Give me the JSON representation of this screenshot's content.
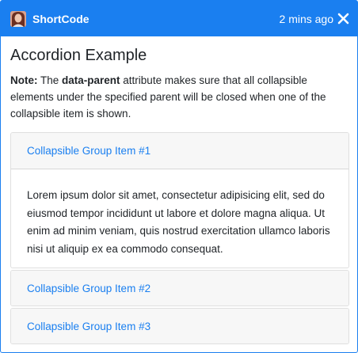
{
  "titlebar": {
    "app_name": "ShortCode",
    "time": "2 mins ago",
    "close_icon": "close-icon"
  },
  "main": {
    "heading": "Accordion Example",
    "note": {
      "label": "Note:",
      "text_1": " The ",
      "highlight": "data-parent",
      "text_2": " attribute makes sure that all collapsible elements under the specified parent will be closed when one of the collapsible item is shown."
    }
  },
  "accordion": {
    "items": [
      {
        "title": "Collapsible Group Item #1",
        "expanded": true,
        "body": "Lorem ipsum dolor sit amet, consectetur adipisicing elit, sed do eiusmod tempor incididunt ut labore et dolore magna aliqua. Ut enim ad minim veniam, quis nostrud exercitation ullamco laboris nisi ut aliquip ex ea commodo consequat."
      },
      {
        "title": "Collapsible Group Item #2",
        "expanded": false
      },
      {
        "title": "Collapsible Group Item #3",
        "expanded": false
      }
    ]
  },
  "colors": {
    "accent": "#1a7ff0",
    "header_bg": "#f7f7f7",
    "text": "#212529"
  }
}
